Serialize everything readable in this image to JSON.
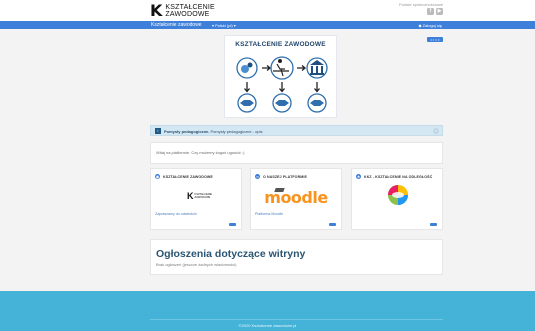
{
  "header": {
    "logo_k": "K",
    "logo_line1": "KSZTAŁCENIE",
    "logo_line2": "ZAWODOWE",
    "social_label": "Portale społecznościowe",
    "social_icons": [
      "facebook-icon",
      "youtube-icon"
    ]
  },
  "navbar": {
    "brand": "Kształcenie zawodowe",
    "language": "▾ Polski (pl) ▾",
    "login": "◆ Zaloguj się"
  },
  "hero": {
    "title": "KSZTAŁCENIE ZAWODOWE",
    "menu_dots": "• • • •"
  },
  "notice": {
    "bold": "Pomysły pedagogiczne.",
    "text": " Pomysły pedagogiczne - opis",
    "close": "×"
  },
  "welcome": {
    "text": "Witaj na platformie. Czy możemy kogoś ugościć :)"
  },
  "cards": [
    {
      "title": "KSZTAŁCENIE ZAWODOWE",
      "link": "Zapraszamy do odwiedzin",
      "icon": "pin-icon"
    },
    {
      "title": "O NASZEJ PLATFORMIE",
      "link": "Platforma Moodle",
      "icon": "link-icon",
      "logo": "moodle"
    },
    {
      "title": "KKZ - KSZTAŁCENIE NA ODLEGŁOŚĆ",
      "link": "",
      "icon": "star-icon"
    }
  ],
  "announcements": {
    "title": "Ogłoszenia dotyczące witryny",
    "text": "Brak ogłoszeń (jeszcze żadnych wiadomości)"
  },
  "footer": {
    "text": "©2020 Kształcenie zawodowe.pl"
  },
  "colors": {
    "navbar": "#3d7fd9",
    "footer": "#45b3d8",
    "heading": "#2a5573",
    "moodle": "#f7931e"
  }
}
